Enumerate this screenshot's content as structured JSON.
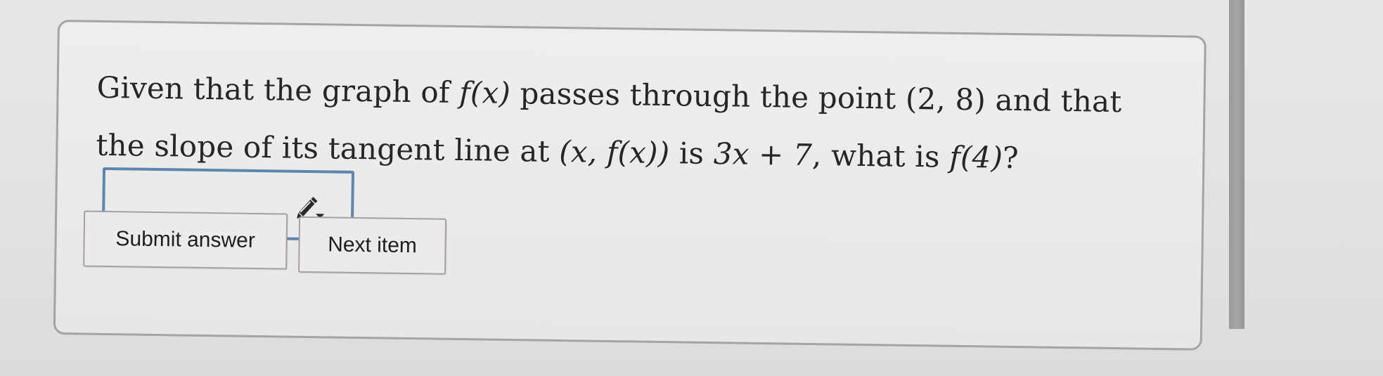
{
  "question": {
    "text_1": "Given that the graph of ",
    "fx": "f(x)",
    "text_2": " passes through the point ",
    "point": "(2, 8)",
    "text_3": " and that the slope of its tangent line at ",
    "xfx": "(x, f(x))",
    "text_4": " is ",
    "slope": "3x + 7",
    "text_5": ", what is ",
    "f4": "f(4)",
    "text_6": "?"
  },
  "answer": {
    "value": "",
    "icon": "pencil-icon"
  },
  "buttons": {
    "submit_label": "Submit answer",
    "next_label": "Next item"
  },
  "colors": {
    "input_border": "#5a86b1",
    "card_border": "#a4a4a4"
  }
}
